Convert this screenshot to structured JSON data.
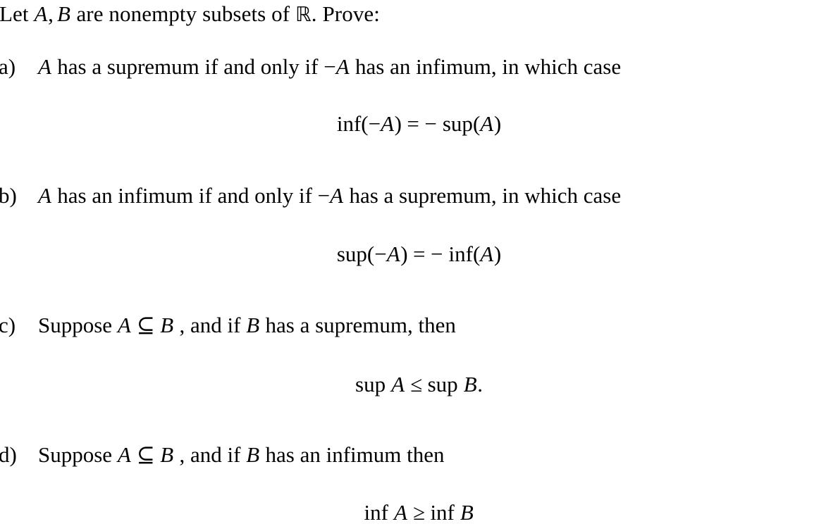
{
  "document": {
    "type": "math-problem-set",
    "background_color": "#ffffff",
    "text_color": "#000000",
    "intro": {
      "prefix": "Let ",
      "var_a": "A",
      "comma": ",",
      "var_b": "B",
      "middle": " are nonempty subsets of ",
      "reals_symbol": "ℝ",
      "suffix": ". Prove:"
    },
    "items": [
      {
        "label": "a)",
        "text_before_math": "A",
        "segments": {
          "s1": " has a supremum if and only if ",
          "minus": "−",
          "var": "A",
          "s2": " has an infimum, in which case"
        },
        "equation": {
          "op1": "inf",
          "open1": "(",
          "minus1": "−",
          "arg1": "A",
          "close1": ")",
          "relation": "=",
          "minus2": "−",
          "op2": "sup",
          "open2": "(",
          "arg2": "A",
          "close2": ")",
          "plain": "inf(−A) = − sup(A)"
        }
      },
      {
        "label": "b)",
        "text_before_math": "A",
        "segments": {
          "s1": " has an infimum if and only if ",
          "minus": "−",
          "var": "A",
          "s2": " has a supremum, in which case"
        },
        "equation": {
          "op1": "sup",
          "open1": "(",
          "minus1": "−",
          "arg1": "A",
          "close1": ")",
          "relation": "=",
          "minus2": "−",
          "op2": "inf",
          "open2": "(",
          "arg2": "A",
          "close2": ")",
          "plain": "sup(−A) = − inf(A)"
        }
      },
      {
        "label": "c)",
        "segments": {
          "s1": "Suppose ",
          "var_a": "A",
          "subset": "⊆",
          "var_b": "B",
          "s2": " , and if ",
          "var_c": "B",
          "s3": " has a supremum, then"
        },
        "equation": {
          "op1": "sup",
          "arg1": "A",
          "relation": "≤",
          "op2": "sup",
          "arg2": "B",
          "period": ".",
          "plain": "sup A ≤ sup B."
        }
      },
      {
        "label": "d)",
        "segments": {
          "s1": "Suppose ",
          "var_a": "A",
          "subset": "⊆",
          "var_b": "B",
          "s2": " , and if ",
          "var_c": "B",
          "s3": " has an infimum then"
        },
        "equation": {
          "op1": "inf",
          "arg1": "A",
          "relation": "≥",
          "op2": "inf",
          "arg2": "B",
          "period": "",
          "plain": "inf A ≥ inf B"
        }
      }
    ]
  }
}
